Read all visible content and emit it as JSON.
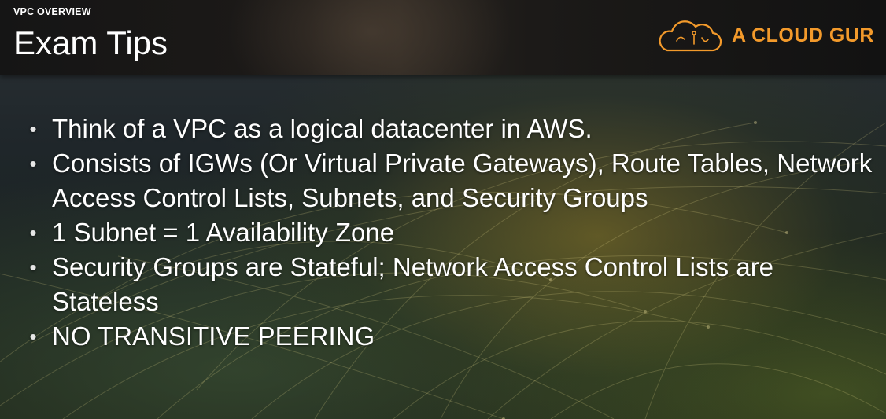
{
  "header": {
    "section_label": "VPC OVERVIEW",
    "title": "Exam Tips",
    "logo_text": "A CLOUD GUR",
    "logo_icon": "cloud-icon",
    "brand_color": "#f39a2b"
  },
  "bullet_glyph": "•",
  "bullets": [
    "Think of a VPC as a logical datacenter in AWS.",
    "Consists of IGWs (Or Virtual Private Gateways), Route Tables, Network Access Control Lists, Subnets, and Security Groups",
    "1 Subnet = 1 Availability Zone",
    "Security Groups are Stateful; Network Access Control Lists are Stateless",
    "NO TRANSITIVE PEERING"
  ]
}
